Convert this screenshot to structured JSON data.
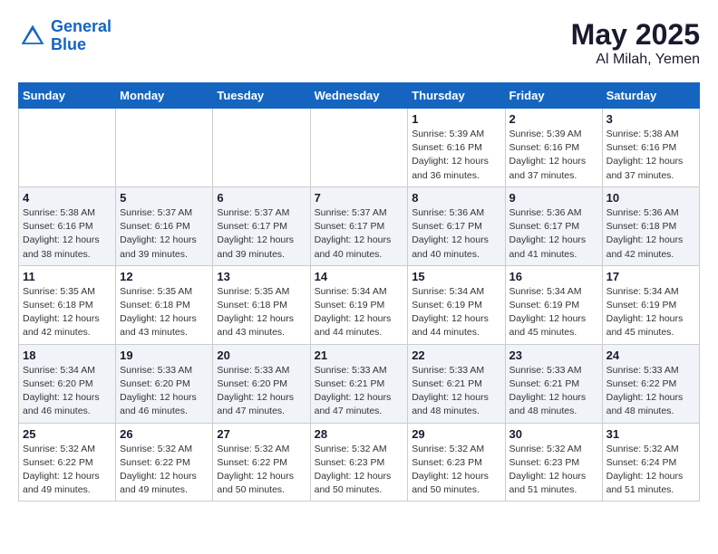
{
  "header": {
    "logo_line1": "General",
    "logo_line2": "Blue",
    "main_title": "May 2025",
    "sub_title": "Al Milah, Yemen"
  },
  "days_header": [
    "Sunday",
    "Monday",
    "Tuesday",
    "Wednesday",
    "Thursday",
    "Friday",
    "Saturday"
  ],
  "weeks": [
    [
      {
        "day": "",
        "info": ""
      },
      {
        "day": "",
        "info": ""
      },
      {
        "day": "",
        "info": ""
      },
      {
        "day": "",
        "info": ""
      },
      {
        "day": "1",
        "info": "Sunrise: 5:39 AM\nSunset: 6:16 PM\nDaylight: 12 hours\nand 36 minutes."
      },
      {
        "day": "2",
        "info": "Sunrise: 5:39 AM\nSunset: 6:16 PM\nDaylight: 12 hours\nand 37 minutes."
      },
      {
        "day": "3",
        "info": "Sunrise: 5:38 AM\nSunset: 6:16 PM\nDaylight: 12 hours\nand 37 minutes."
      }
    ],
    [
      {
        "day": "4",
        "info": "Sunrise: 5:38 AM\nSunset: 6:16 PM\nDaylight: 12 hours\nand 38 minutes."
      },
      {
        "day": "5",
        "info": "Sunrise: 5:37 AM\nSunset: 6:16 PM\nDaylight: 12 hours\nand 39 minutes."
      },
      {
        "day": "6",
        "info": "Sunrise: 5:37 AM\nSunset: 6:17 PM\nDaylight: 12 hours\nand 39 minutes."
      },
      {
        "day": "7",
        "info": "Sunrise: 5:37 AM\nSunset: 6:17 PM\nDaylight: 12 hours\nand 40 minutes."
      },
      {
        "day": "8",
        "info": "Sunrise: 5:36 AM\nSunset: 6:17 PM\nDaylight: 12 hours\nand 40 minutes."
      },
      {
        "day": "9",
        "info": "Sunrise: 5:36 AM\nSunset: 6:17 PM\nDaylight: 12 hours\nand 41 minutes."
      },
      {
        "day": "10",
        "info": "Sunrise: 5:36 AM\nSunset: 6:18 PM\nDaylight: 12 hours\nand 42 minutes."
      }
    ],
    [
      {
        "day": "11",
        "info": "Sunrise: 5:35 AM\nSunset: 6:18 PM\nDaylight: 12 hours\nand 42 minutes."
      },
      {
        "day": "12",
        "info": "Sunrise: 5:35 AM\nSunset: 6:18 PM\nDaylight: 12 hours\nand 43 minutes."
      },
      {
        "day": "13",
        "info": "Sunrise: 5:35 AM\nSunset: 6:18 PM\nDaylight: 12 hours\nand 43 minutes."
      },
      {
        "day": "14",
        "info": "Sunrise: 5:34 AM\nSunset: 6:19 PM\nDaylight: 12 hours\nand 44 minutes."
      },
      {
        "day": "15",
        "info": "Sunrise: 5:34 AM\nSunset: 6:19 PM\nDaylight: 12 hours\nand 44 minutes."
      },
      {
        "day": "16",
        "info": "Sunrise: 5:34 AM\nSunset: 6:19 PM\nDaylight: 12 hours\nand 45 minutes."
      },
      {
        "day": "17",
        "info": "Sunrise: 5:34 AM\nSunset: 6:19 PM\nDaylight: 12 hours\nand 45 minutes."
      }
    ],
    [
      {
        "day": "18",
        "info": "Sunrise: 5:34 AM\nSunset: 6:20 PM\nDaylight: 12 hours\nand 46 minutes."
      },
      {
        "day": "19",
        "info": "Sunrise: 5:33 AM\nSunset: 6:20 PM\nDaylight: 12 hours\nand 46 minutes."
      },
      {
        "day": "20",
        "info": "Sunrise: 5:33 AM\nSunset: 6:20 PM\nDaylight: 12 hours\nand 47 minutes."
      },
      {
        "day": "21",
        "info": "Sunrise: 5:33 AM\nSunset: 6:21 PM\nDaylight: 12 hours\nand 47 minutes."
      },
      {
        "day": "22",
        "info": "Sunrise: 5:33 AM\nSunset: 6:21 PM\nDaylight: 12 hours\nand 48 minutes."
      },
      {
        "day": "23",
        "info": "Sunrise: 5:33 AM\nSunset: 6:21 PM\nDaylight: 12 hours\nand 48 minutes."
      },
      {
        "day": "24",
        "info": "Sunrise: 5:33 AM\nSunset: 6:22 PM\nDaylight: 12 hours\nand 48 minutes."
      }
    ],
    [
      {
        "day": "25",
        "info": "Sunrise: 5:32 AM\nSunset: 6:22 PM\nDaylight: 12 hours\nand 49 minutes."
      },
      {
        "day": "26",
        "info": "Sunrise: 5:32 AM\nSunset: 6:22 PM\nDaylight: 12 hours\nand 49 minutes."
      },
      {
        "day": "27",
        "info": "Sunrise: 5:32 AM\nSunset: 6:22 PM\nDaylight: 12 hours\nand 50 minutes."
      },
      {
        "day": "28",
        "info": "Sunrise: 5:32 AM\nSunset: 6:23 PM\nDaylight: 12 hours\nand 50 minutes."
      },
      {
        "day": "29",
        "info": "Sunrise: 5:32 AM\nSunset: 6:23 PM\nDaylight: 12 hours\nand 50 minutes."
      },
      {
        "day": "30",
        "info": "Sunrise: 5:32 AM\nSunset: 6:23 PM\nDaylight: 12 hours\nand 51 minutes."
      },
      {
        "day": "31",
        "info": "Sunrise: 5:32 AM\nSunset: 6:24 PM\nDaylight: 12 hours\nand 51 minutes."
      }
    ]
  ]
}
